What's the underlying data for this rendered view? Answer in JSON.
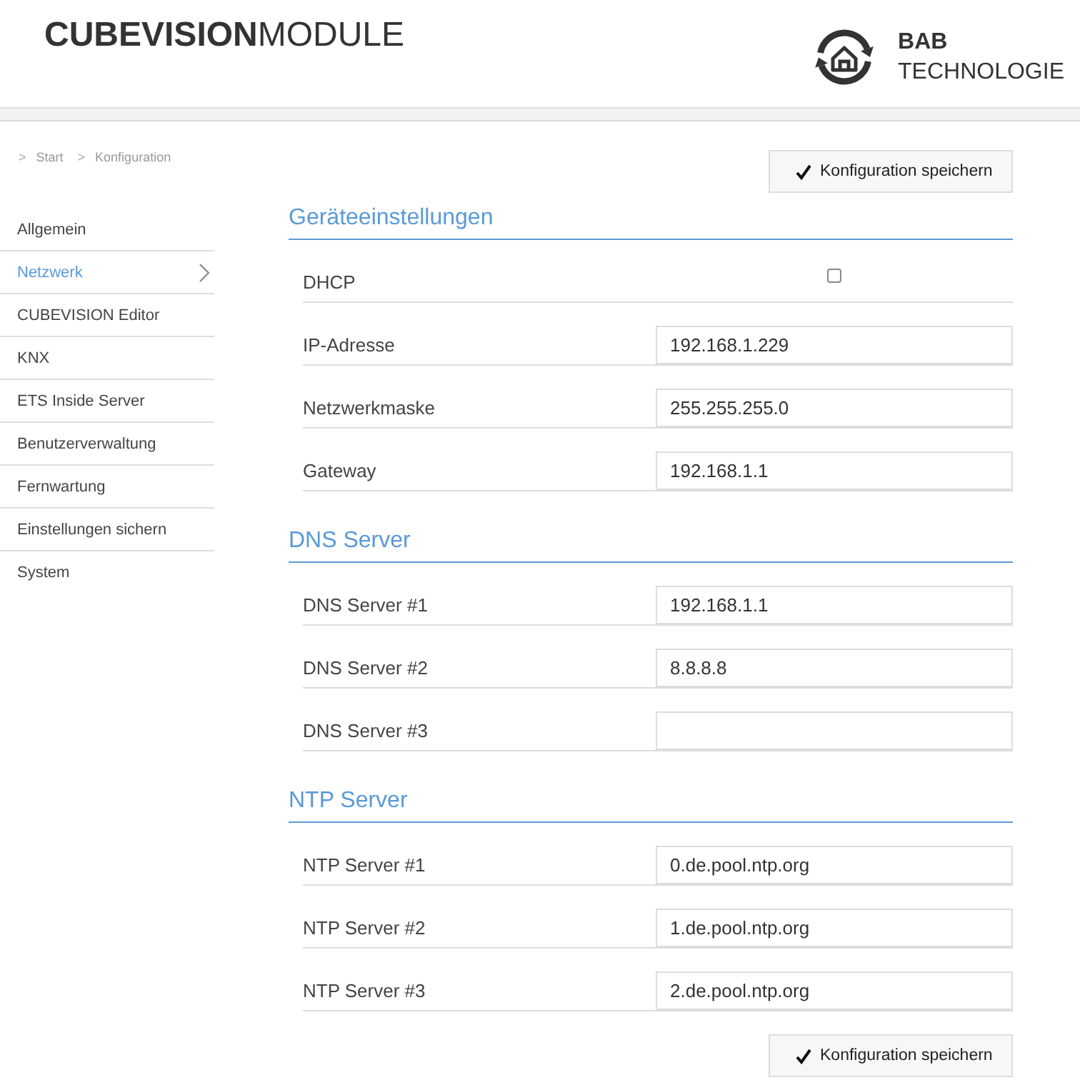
{
  "header": {
    "logo": "**CUBEVISION**MODULE",
    "brand": {
      "line_1": "BAB",
      "line_2": "TECHNOLOGIE"
    }
  },
  "breadcrumb": [
    {
      "separator": ">",
      "label": "Start"
    },
    {
      "separator": ">",
      "label": "Konfiguration"
    }
  ],
  "sidebar": {
    "items": [
      {
        "label": "Allgemein",
        "selected": false
      },
      {
        "label": "Netzwerk",
        "selected": true
      },
      {
        "label": "CUBEVISION Editor",
        "selected": false
      },
      {
        "label": "KNX",
        "selected": false
      },
      {
        "label": "ETS Inside Server",
        "selected": false
      },
      {
        "label": "Benutzerverwaltung",
        "selected": false
      },
      {
        "label": "Fernwartung",
        "selected": false
      },
      {
        "label": "Einstellungen sichern",
        "selected": false
      },
      {
        "label": "System",
        "selected": false
      }
    ]
  },
  "save_button_top": {
    "label": "Konfiguration speichern"
  },
  "sections": [
    {
      "title": "Geräteeinstellungen",
      "rows": [
        {
          "kind": "checkbox",
          "label": "DHCP",
          "checked": false
        },
        {
          "kind": "text",
          "label": "IP-Adresse",
          "value": "192.168.1.229"
        },
        {
          "kind": "text",
          "label": "Netzwerkmaske",
          "value": "255.255.255.0"
        },
        {
          "kind": "text",
          "label": "Gateway",
          "value": "192.168.1.1"
        }
      ]
    },
    {
      "title": "DNS Server",
      "rows": [
        {
          "kind": "text",
          "label": "DNS Server #1",
          "value": "192.168.1.1"
        },
        {
          "kind": "text",
          "label": "DNS Server #2",
          "value": "8.8.8.8"
        },
        {
          "kind": "text",
          "label": "DNS Server #3"
        }
      ]
    },
    {
      "title": "NTP Server",
      "rows": [
        {
          "kind": "text",
          "label": "NTP Server #1",
          "value": "0.de.pool.ntp.org"
        },
        {
          "kind": "text",
          "label": "NTP Server #2",
          "value": "1.de.pool.ntp.org"
        },
        {
          "kind": "text",
          "label": "NTP Server #3",
          "value": "2.de.pool.ntp.org"
        }
      ]
    }
  ],
  "save_button_bottom": {
    "label": "Konfiguration speichern"
  }
}
